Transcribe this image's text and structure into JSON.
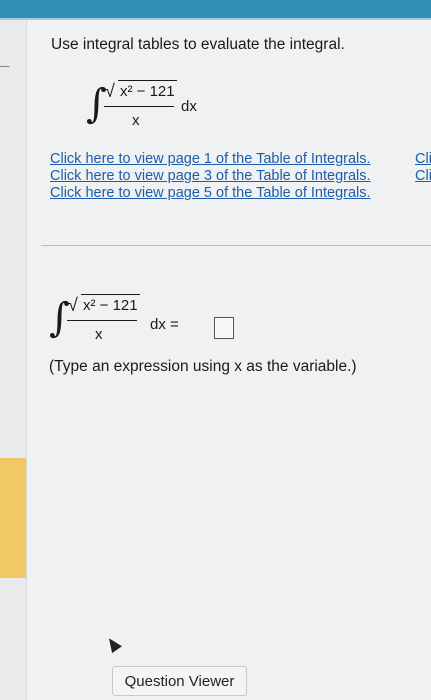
{
  "question": {
    "instruction": "Use integral tables to evaluate the integral.",
    "integral": {
      "radicand": "x² − 121",
      "denominator": "x",
      "differential": "dx"
    }
  },
  "links": [
    "Click here to view page 1 of the Table of Integrals.",
    "Click here to view page 3 of the Table of Integrals.",
    "Click here to view page 5 of the Table of Integrals."
  ],
  "links_overflow": [
    "Cli",
    "Cli"
  ],
  "answer": {
    "radicand": "x² − 121",
    "denominator": "x",
    "equals": "dx =",
    "value": ""
  },
  "hint": "(Type an expression using x as the variable.)",
  "buttons": {
    "question_viewer": "Question Viewer"
  },
  "icons": {
    "back": "back-arrow-icon",
    "cursor": "mouse-pointer-icon"
  },
  "colors": {
    "link": "#1e5dab",
    "topbar": "#2f8fb4",
    "accent_strip": "#f1c34a"
  }
}
